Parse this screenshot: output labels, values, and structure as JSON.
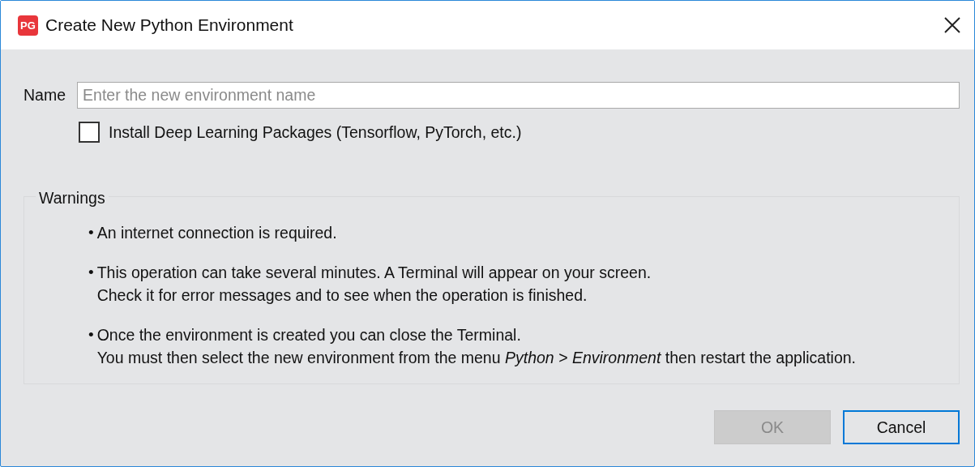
{
  "window": {
    "title": "Create New Python Environment",
    "app_badge": "PG"
  },
  "name_field": {
    "label": "Name",
    "placeholder": "Enter the new environment name"
  },
  "checkbox": {
    "label": "Install Deep Learning Packages (Tensorflow, PyTorch, etc.)",
    "checked": false
  },
  "warnings": {
    "title": "Warnings",
    "items": [
      {
        "bullet": "•",
        "lines": [
          "An internet connection is required."
        ]
      },
      {
        "bullet": "•",
        "lines": [
          "This operation can take several minutes. A Terminal will appear on your screen.",
          "Check it for error messages and to see when the operation is finished."
        ]
      },
      {
        "bullet": "•",
        "lines": [
          "Once the environment is created you can close the Terminal.",
          "You must then select the new environment from the menu *Python > Environment* then restart the application."
        ]
      }
    ]
  },
  "buttons": [
    {
      "label": "OK",
      "disabled": true
    },
    {
      "label": "Cancel",
      "disabled": false
    }
  ]
}
